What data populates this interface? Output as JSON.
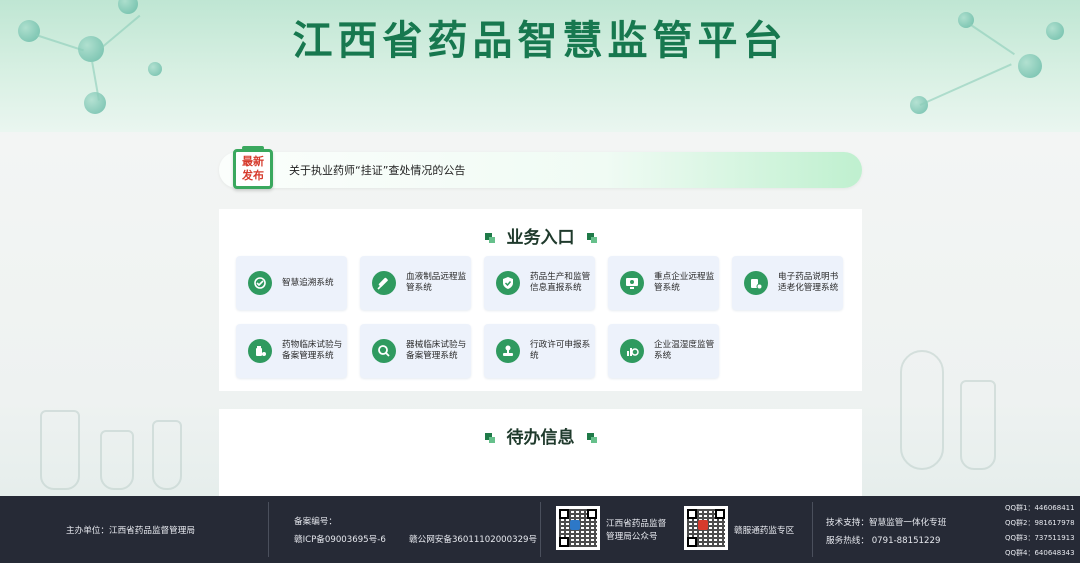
{
  "header": {
    "title": "江西省药品智慧监管平台"
  },
  "notice": {
    "badge_line1": "最新",
    "badge_line2": "发布",
    "text": "关于执业药师“挂证”查处情况的公告"
  },
  "business": {
    "title": "业务入口",
    "items": [
      {
        "label": "智慧追溯系统",
        "icon": "trace-icon"
      },
      {
        "label": "血液制品远程监管系统",
        "icon": "syringe-icon"
      },
      {
        "label": "药品生产和监管信息直报系统",
        "icon": "shield-check-icon"
      },
      {
        "label": "重点企业远程监管系统",
        "icon": "monitor-icon"
      },
      {
        "label": "电子药品说明书适老化管理系统",
        "icon": "medicine-gear-icon"
      },
      {
        "label": "药物临床试验与备案管理系统",
        "icon": "pill-bottle-icon"
      },
      {
        "label": "器械临床试验与备案管理系统",
        "icon": "search-device-icon"
      },
      {
        "label": "行政许可申报系统",
        "icon": "stamp-icon"
      },
      {
        "label": "企业温湿度监管系统",
        "icon": "thermometer-chart-icon"
      }
    ]
  },
  "todo": {
    "title": "待办信息"
  },
  "footer": {
    "sponsor": "主办单位：江西省药品监督管理局",
    "record_label": "备案编号：",
    "icp": "赣ICP备09003695号-6",
    "police": "赣公网安备36011102000329号",
    "qr1_label_line1": "江西省药品监督",
    "qr1_label_line2": "管理局公众号",
    "qr2_label": "赣服通药监专区",
    "tech_support": "技术支持：智慧监管一体化专班",
    "hotline": "服务热线：  0791-88151229",
    "qq": [
      "QQ群1：446068411",
      "QQ群2：981617978",
      "QQ群3：737511913",
      "QQ群4：640648343"
    ]
  },
  "colors": {
    "title_green": "#17784f",
    "icon_green": "#2f9a5f",
    "footer_bg": "#262a36",
    "badge_red": "#d63a2c"
  }
}
